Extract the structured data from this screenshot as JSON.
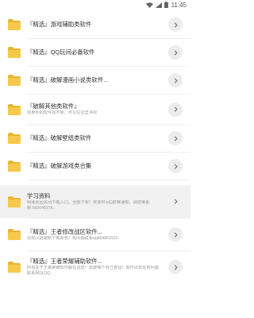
{
  "status_bar": {
    "time": "11:45"
  },
  "colors": {
    "folder": "#F7C94B",
    "folder_dark": "#E9B533",
    "chevron_bg": "#ECECEC",
    "highlight_bg": "#F1F1F1"
  },
  "items": [
    {
      "title": "『精选』游戏辅助类软件",
      "subtitle": ""
    },
    {
      "title": "『精选』QQ玩间必备软件",
      "subtitle": ""
    },
    {
      "title": "『精选』破解漫画小说类软件...",
      "subtitle": ""
    },
    {
      "title": "『破解其他类软件』",
      "subtitle": "如果你的软件找不到，可以在这里寻找"
    },
    {
      "title": "『精选』破解壁纸类软件",
      "subtitle": ""
    },
    {
      "title": "『精选』破解游戏类合集",
      "subtitle": ""
    },
    {
      "title": "学习资料",
      "subtitle": "特殊原因关闭下载入口，全部下架！恢复时间Q群等通知，目群等更新:560645376..."
    },
    {
      "title": "『精选』王者修改战区软件...",
      "subtitle": "出现闪退跟新下载原包！有问题联系qq404863915"
    },
    {
      "title": "『精选』王者荣耀辅助软件...",
      "subtitle": "所有关于王者荣耀软件都在这里！需要哪个自己查找！软件出现任何问题联系网址QQ..."
    }
  ]
}
